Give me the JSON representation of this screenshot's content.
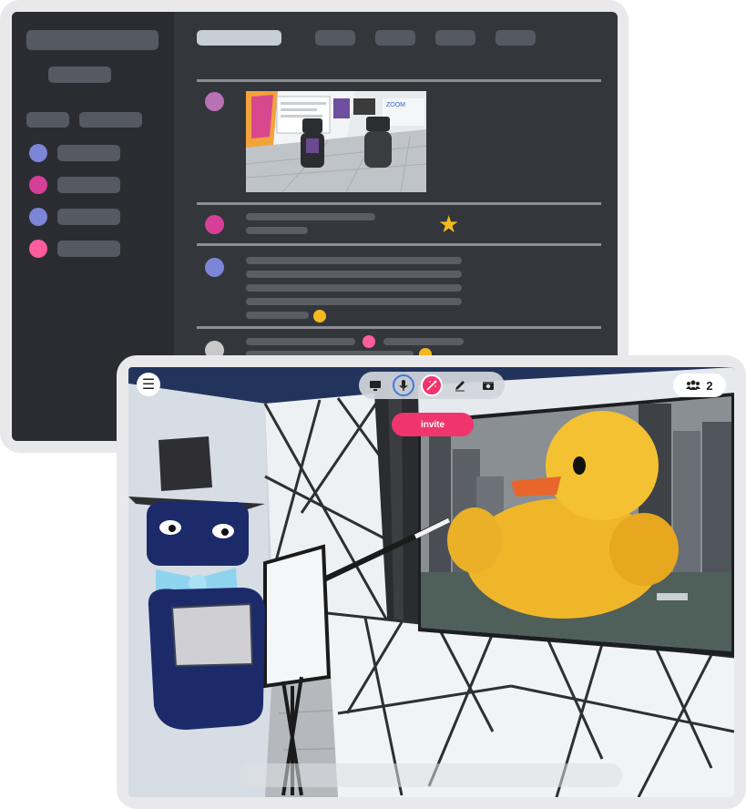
{
  "front_window": {
    "invite_label": "invite",
    "participant_count": "2",
    "toolbar": {
      "items": [
        "screen-share",
        "microphone",
        "magic-wand",
        "pencil",
        "camera"
      ],
      "active_item": "microphone",
      "highlight_item": "magic-wand"
    }
  },
  "back_window": {
    "avatar_colors": [
      "#7b86d9",
      "#d63f98",
      "#7b86d9",
      "#ff5d9e"
    ],
    "message_avatar_colors": [
      "#b872b4",
      "#d63f98",
      "#7b86d9",
      "#c9c9c9"
    ],
    "reaction_colors": [
      "#f4b91f",
      "#ff5d9e"
    ]
  },
  "colors": {
    "accent": "#f0356c",
    "star": "#f4b91f",
    "mic_active": "#3d7be0"
  }
}
